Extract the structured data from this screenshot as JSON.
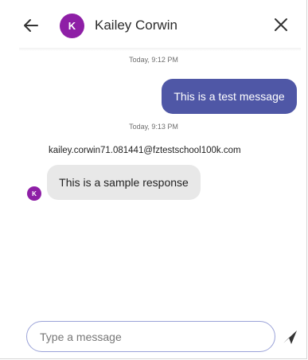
{
  "header": {
    "avatar_initial": "K",
    "contact_name": "Kailey Corwin"
  },
  "conversation": {
    "messages": [
      {
        "timestamp": "Today, 9:12 PM",
        "direction": "outgoing",
        "text": "This is a test message"
      },
      {
        "timestamp": "Today, 9:13 PM",
        "direction": "incoming",
        "sender": "kailey.corwin71.081441@fztestschool100k.com",
        "avatar_initial": "K",
        "text": "This is a sample response"
      }
    ]
  },
  "composer": {
    "placeholder": "Type a message",
    "value": ""
  },
  "icons": {
    "back": "arrow-left-icon",
    "close": "close-icon",
    "send": "send-icon"
  },
  "colors": {
    "avatar": "#8e1fa6",
    "outgoing_bubble": "#4f57a6",
    "incoming_bubble": "#e8e8e8",
    "composer_border": "#9aa2d8"
  }
}
